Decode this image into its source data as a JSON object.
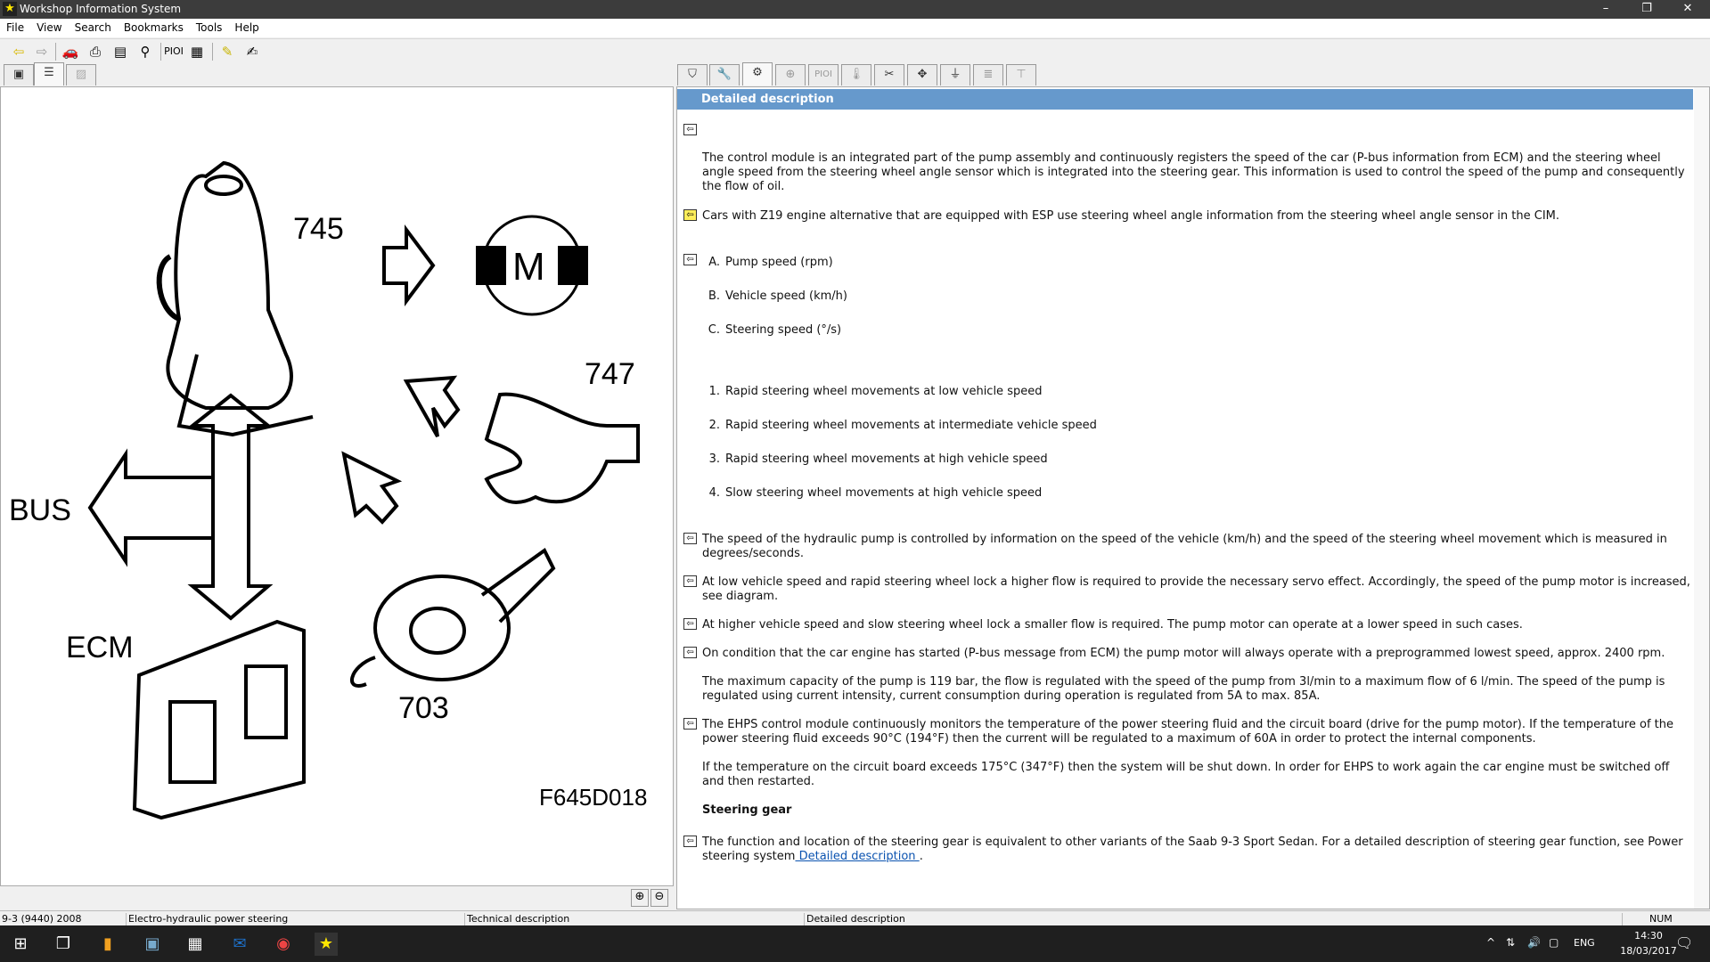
{
  "window": {
    "title": "Workshop Information System",
    "minimize": "–",
    "restore": "❐",
    "close": "✕"
  },
  "menu": [
    "File",
    "View",
    "Search",
    "Bookmarks",
    "Tools",
    "Help"
  ],
  "toolbar": {
    "pioi": "PIOI"
  },
  "right_tabs": {
    "pioi": "PIOI"
  },
  "diagram": {
    "label_745": "745",
    "label_747": "747",
    "label_703": "703",
    "label_bus": "BUS",
    "label_ecm": "ECM",
    "motor": "M",
    "figure_id": "F645D018"
  },
  "content": {
    "header": "Detailed description",
    "p1": "The control module is an integrated part of the pump assembly and continuously registers the speed of the car (P-bus information from ECM) and the steering wheel angle speed from the steering wheel angle sensor which is integrated into the steering gear. This information is used to control the speed of the pump and consequently the flow of oil.",
    "p2": "Cars with Z19 engine alternative that are equipped with ESP use steering wheel angle information from the steering wheel angle sensor in the CIM.",
    "letters": [
      {
        "n": "A.",
        "t": "Pump speed (rpm)"
      },
      {
        "n": "B.",
        "t": "Vehicle speed (km/h)"
      },
      {
        "n": "C.",
        "t": "Steering speed (°/s)"
      }
    ],
    "numbers": [
      {
        "n": "1.",
        "t": "Rapid steering wheel movements at low vehicle speed"
      },
      {
        "n": "2.",
        "t": "Rapid steering wheel movements at intermediate vehicle speed"
      },
      {
        "n": "3.",
        "t": "Rapid steering wheel movements at high vehicle speed"
      },
      {
        "n": "4.",
        "t": "Slow steering wheel movements at high vehicle speed"
      }
    ],
    "p3": "The speed of the hydraulic pump is controlled by information on the speed of the vehicle (km/h) and the speed of the steering wheel movement which is measured in degrees/seconds.",
    "p4": "At low vehicle speed and rapid steering wheel lock a higher flow is required to provide the necessary servo effect. Accordingly, the speed of the pump motor is increased, see diagram.",
    "p5": "At higher vehicle speed and slow steering wheel lock a smaller flow is required. The pump motor can operate at a lower speed in such cases.",
    "p6": "On condition that the car engine has started (P-bus message from ECM) the pump motor will always operate with a preprogrammed lowest speed, approx. 2400 rpm.",
    "p7": "The maximum capacity of the pump is 119 bar, the flow is regulated with the speed of the pump from 3l/min to a maximum flow of 6 l/min. The speed of the pump is regulated using current intensity, current consumption during operation is regulated from 5A to max. 85A.",
    "p8": "The EHPS control module continuously monitors the temperature of the power steering fluid and the circuit board (drive for the pump motor). If the temperature of the power steering fluid exceeds 90°C (194°F) then the current will be regulated to a maximum of 60A in order to protect the internal components.",
    "p9": "If the temperature on the circuit board exceeds 175°C (347°F) then the system will be shut down. In order for EHPS to work again the car engine must be switched off and then restarted.",
    "heading": "Steering gear",
    "p10": "The function and location of the steering gear is equivalent to other variants of the Saab 9-3 Sport Sedan. For a detailed description of steering gear function, see Power steering system",
    "p10_link": " Detailed description ",
    "p10_end": "."
  },
  "status": [
    "9-3 (9440) 2008",
    "Electro-hydraulic power steering",
    "Technical description",
    "Detailed description",
    "NUM"
  ],
  "taskbar": {
    "lang": "ENG",
    "time": "14:30",
    "date": "18/03/2017"
  }
}
